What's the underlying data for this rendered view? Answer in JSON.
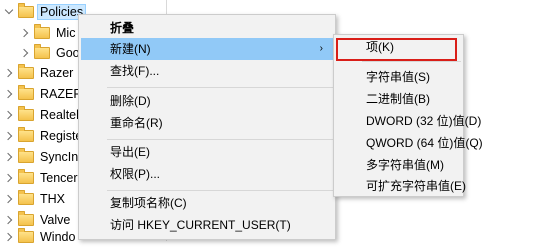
{
  "tree": {
    "items": [
      {
        "label": "Policies",
        "selected": true
      },
      {
        "label": "Mic"
      },
      {
        "label": "Goo"
      },
      {
        "label": "Razer"
      },
      {
        "label": "RAZER"
      },
      {
        "label": "Realtel"
      },
      {
        "label": "Registe"
      },
      {
        "label": "SyncInt"
      },
      {
        "label": "Tencer"
      },
      {
        "label": "THX"
      },
      {
        "label": "Valve"
      },
      {
        "label": "Windo"
      }
    ]
  },
  "context_menu": {
    "items": [
      {
        "label": "折叠"
      },
      {
        "label": "新建(N)",
        "arrow": "›"
      },
      {
        "label": "查找(F)..."
      },
      {
        "label": "删除(D)"
      },
      {
        "label": "重命名(R)"
      },
      {
        "label": "导出(E)"
      },
      {
        "label": "权限(P)..."
      },
      {
        "label": "复制项名称(C)"
      },
      {
        "label": "访问 HKEY_CURRENT_USER(T)"
      }
    ]
  },
  "new_submenu": {
    "items": [
      {
        "label": "项(K)"
      },
      {
        "label": "字符串值(S)"
      },
      {
        "label": "二进制值(B)"
      },
      {
        "label": "DWORD (32 位)值(D)"
      },
      {
        "label": "QWORD (64 位)值(Q)"
      },
      {
        "label": "多字符串值(M)"
      },
      {
        "label": "可扩充字符串值(E)"
      }
    ]
  },
  "colors": {
    "hover": "#91c9f7",
    "annotation_box": "#d91e18",
    "selection": "#cce8ff"
  }
}
